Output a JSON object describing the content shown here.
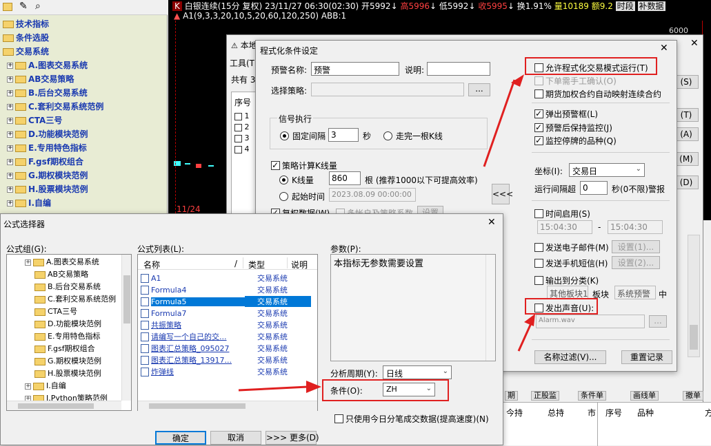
{
  "left_toolbar": {
    "items": [
      "folder-icon",
      "edit-icon",
      "search-icon"
    ]
  },
  "left_tree": {
    "items": [
      {
        "label": "技术指标",
        "level": 0
      },
      {
        "label": "条件选股",
        "level": 0
      },
      {
        "label": "交易系统",
        "level": 0
      },
      {
        "label": "A.图表交易系统",
        "level": 1
      },
      {
        "label": "AB交易策略",
        "level": 1
      },
      {
        "label": "B.后台交易系统",
        "level": 1
      },
      {
        "label": "C.套利交易系统范例",
        "level": 1
      },
      {
        "label": "CTA三号",
        "level": 1
      },
      {
        "label": "D.功能模块范例",
        "level": 1
      },
      {
        "label": "E.专用特色指标",
        "level": 1
      },
      {
        "label": "F.gsf期权组合",
        "level": 1
      },
      {
        "label": "G.期权模块范例",
        "level": 1
      },
      {
        "label": "H.股票模块范例",
        "level": 1
      },
      {
        "label": "I.自编",
        "level": 1
      }
    ]
  },
  "chart_header": {
    "symbol_badge": "K",
    "title": "白银连续(15分 复权) 23/11/27 06:30(02:30)",
    "open": "开5992",
    "high": "高5996",
    "low": "低5992",
    "close": "收5995",
    "turnover": "换1.91%",
    "volume": "量10189",
    "amount": "额9.2",
    "period": "时段",
    "extra": "补数据",
    "indicator_line": "A1(9,3,3,20,10,5,20,60,120,250) ABB:1",
    "price_label": "6000",
    "date_label": "11/24"
  },
  "bg_window": {
    "title": "本地",
    "toolbar": "工具(T)",
    "count_label": "共有 30",
    "col_seq": "序号",
    "rows": [
      "1",
      "2",
      "3",
      "4"
    ],
    "right_buttons": [
      "(S)",
      "(T)",
      "(A)",
      "(M)",
      "(D)"
    ],
    "bottom_tabs": [
      "期",
      "正股监",
      "条件单",
      "画线单",
      "撤单"
    ],
    "bottom_cols": [
      "今持",
      "总持",
      "市",
      "序号",
      "品种",
      "方"
    ]
  },
  "cond_dialog": {
    "title": "程式化条件设定",
    "alert_name_label": "预警名称:",
    "alert_name_value": "预警",
    "desc_label": "说明:",
    "desc_value": "",
    "strategy_label": "选择策略:",
    "strategy_value": "",
    "browse_label": "...",
    "signal_group": "信号执行",
    "fixed_interval": "固定间隔",
    "interval_value": "3",
    "seconds": "秒",
    "after_bar": "走完一根K线",
    "calc_kline": "策略计算K线量",
    "kline_label": "K线量",
    "kline_value": "860",
    "kline_hint": "根 (推荐1000以下可提高效率)",
    "start_time_label": "起始时间",
    "start_time_value": "2023.08.09 00:00:00",
    "adjust_label": "复权数据(W)",
    "multi_label": "多帐户及策略系数",
    "settings_label": "设置",
    "collapse_label": "<<<",
    "allow_auto": "允许程式化交易模式运行(T)",
    "manual_confirm": "下单需手工确认(O)",
    "map_contract": "期货加权合约自动映射连续合约",
    "popup_alert": "弹出预警框(L)",
    "keep_monitor": "预警后保持监控(J)",
    "monitor_halt": "监控停牌的品种(Q)",
    "axis_label": "坐标(I):",
    "axis_value": "交易日",
    "interval_run_label": "运行间隔超",
    "interval_run_value": "0",
    "interval_run_suffix": "秒(0不限)警报",
    "time_enable": "时间启用(S)",
    "time_from": "15:04:30",
    "time_dash": "-",
    "time_to": "15:04:30",
    "send_email": "发送电子邮件(M)",
    "email_settings": "设置(1)...",
    "send_sms": "发送手机短信(H)",
    "sms_settings": "设置(2)...",
    "output_category": "输出到分类(K)",
    "other_block": "其他板块1",
    "block_label": "板块",
    "system_alert": "系统预警",
    "mid_label": "中",
    "sound": "发出声音(U):",
    "sound_file": "Alarm.wav",
    "sound_browse": "...",
    "name_filter": "名称过滤(V)...",
    "reset_record": "重置记录"
  },
  "formula_dialog": {
    "title": "公式选择器",
    "group_label": "公式组(G):",
    "groups": [
      "A.图表交易系统",
      "AB交易策略",
      "B.后台交易系统",
      "C.套利交易系统范例",
      "CTA三号",
      "D.功能模块范例",
      "E.专用特色指标",
      "F.gsf期权组合",
      "G.期权模块范例",
      "H.股票模块范例",
      "I.自编",
      "J.Python策略范例"
    ],
    "list_label": "公式列表(L):",
    "col_name": "名称",
    "col_slash": "/",
    "col_type": "类型",
    "col_desc": "说明",
    "formulas": [
      {
        "name": "A1",
        "type": "交易系统",
        "selected": false,
        "link": false
      },
      {
        "name": "Formula4",
        "type": "交易系统",
        "selected": false,
        "link": false
      },
      {
        "name": "Formula5",
        "type": "交易系统",
        "selected": true,
        "link": false
      },
      {
        "name": "Formula7",
        "type": "交易系统",
        "selected": false,
        "link": false
      },
      {
        "name": "共振策略",
        "type": "交易系统",
        "selected": false,
        "link": true
      },
      {
        "name": "请编写一个自己的交...",
        "type": "交易系统",
        "selected": false,
        "link": true
      },
      {
        "name": "图表汇总策略_095027",
        "type": "交易系统",
        "selected": false,
        "link": true
      },
      {
        "name": "图表汇总策略_13917...",
        "type": "交易系统",
        "selected": false,
        "link": true
      },
      {
        "name": "炸弹线",
        "type": "交易系统",
        "selected": false,
        "link": true
      }
    ],
    "params_label": "参数(P):",
    "params_text": "本指标无参数需要设置",
    "period_label": "分析周期(Y):",
    "period_value": "日线",
    "condition_label": "条件(O):",
    "condition_value": "ZH",
    "today_only": "只使用今日分笔成交数据(提高速度)(N)",
    "ok": "确定",
    "cancel": "取消",
    "more": ">>> 更多(D)"
  },
  "colors": {
    "red": "#e02020",
    "chart_bg": "#000000",
    "tree_bg": "#e8ecd4",
    "selection": "#0078d7",
    "link": "#1a3ab0"
  }
}
